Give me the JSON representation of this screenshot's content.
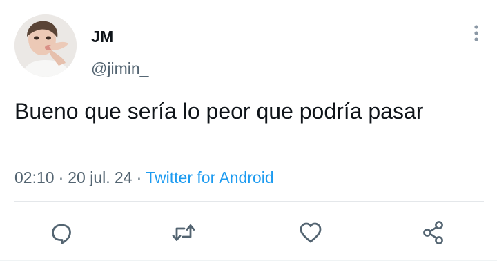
{
  "tweet": {
    "display_name": "JM",
    "handle": "@jimin_",
    "text": "Bueno que sería lo peor que podría pasar",
    "time": "02:10",
    "date": "20 jul. 24",
    "separator": "·",
    "source": "Twitter for Android"
  },
  "icons": {
    "more": "more-vertical-icon",
    "reply": "reply-icon",
    "retweet": "retweet-icon",
    "like": "heart-icon",
    "share": "share-icon"
  },
  "colors": {
    "text": "#0f1419",
    "secondary": "#536471",
    "link": "#1d9bf0",
    "divider": "#e4e7ea"
  }
}
